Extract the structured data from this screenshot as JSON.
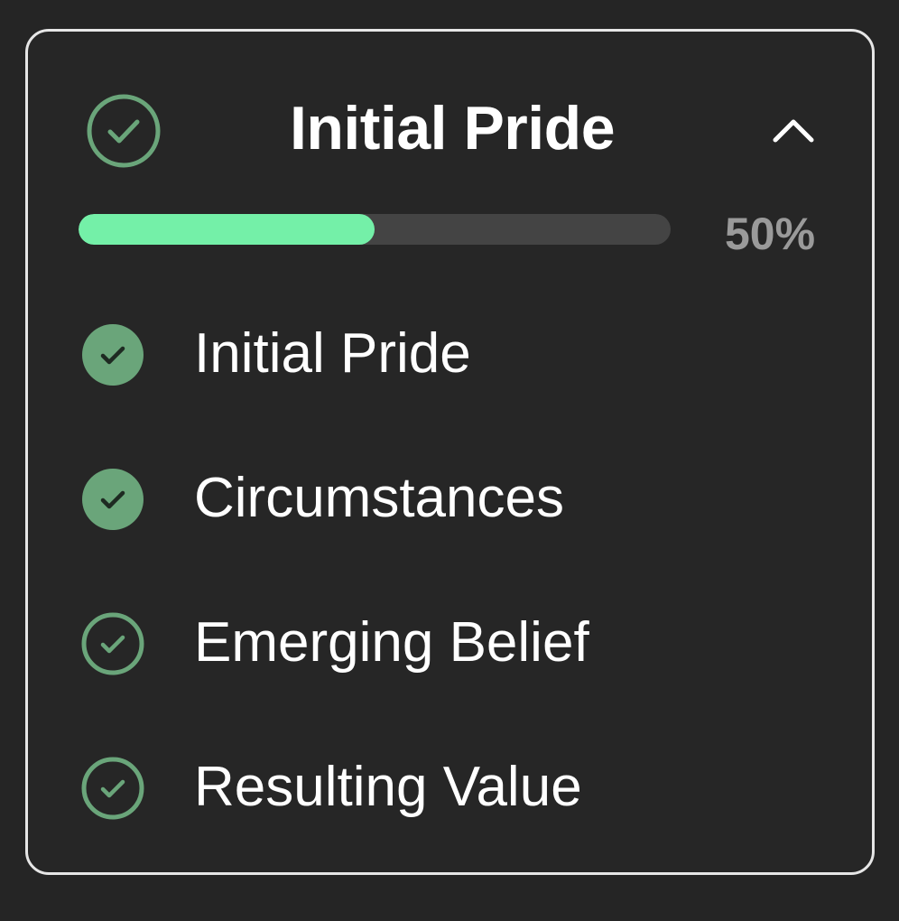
{
  "section": {
    "title": "Initial Pride",
    "status_icon": "circle-check-outline-icon",
    "collapse_icon": "chevron-up-icon"
  },
  "progress": {
    "value": 0.5,
    "label": "50%"
  },
  "steps": [
    {
      "label": "Initial Pride",
      "icon": "circle-check-filled-icon",
      "completed": true
    },
    {
      "label": "Circumstances",
      "icon": "circle-check-filled-icon",
      "completed": true
    },
    {
      "label": "Emerging Belief",
      "icon": "circle-check-outline-icon",
      "completed": false
    },
    {
      "label": "Resulting Value",
      "icon": "circle-check-outline-icon",
      "completed": false
    }
  ],
  "colors": {
    "background": "#252525",
    "card_border": "#e6e6e6",
    "accent_green": "#74f0a8",
    "check_green": "#6aa57a",
    "track": "#444444",
    "muted_text": "#9a9a9a",
    "text": "#ffffff"
  }
}
